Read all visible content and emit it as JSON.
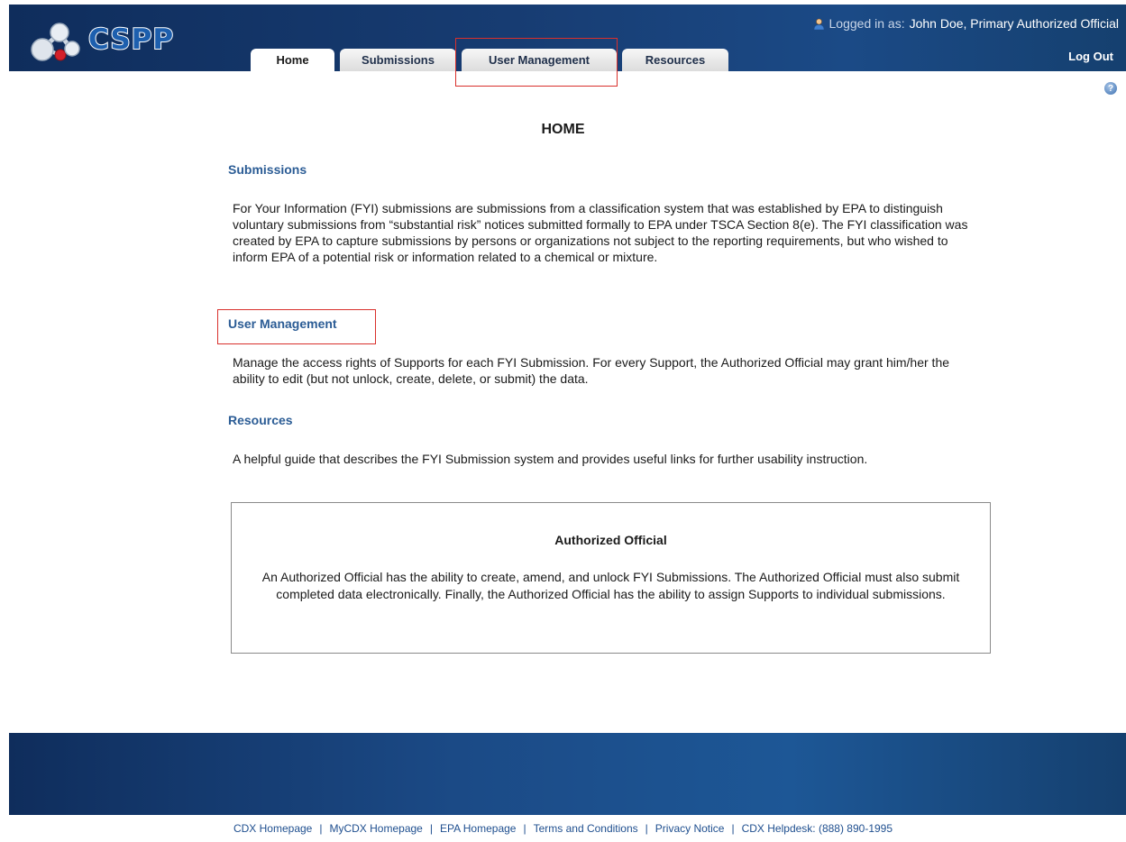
{
  "app": {
    "logo_text": "CSPP"
  },
  "header": {
    "login_label": "Logged in as:",
    "user_name": "John Doe, Primary Authorized Official",
    "logout_label": "Log Out"
  },
  "tabs": [
    {
      "label": "Home",
      "active": true
    },
    {
      "label": "Submissions",
      "active": false
    },
    {
      "label": "User Management",
      "active": false
    },
    {
      "label": "Resources",
      "active": false
    }
  ],
  "help_icon_glyph": "?",
  "main": {
    "page_title": "HOME",
    "sections": [
      {
        "heading": "Submissions",
        "text": "For Your Information (FYI) submissions are submissions from a classification system that was established by EPA to distinguish voluntary submissions from “substantial risk” notices submitted formally to EPA under TSCA Section 8(e). The FYI classification was created by EPA to capture submissions by persons or organizations not subject to the reporting requirements, but who wished to inform EPA of a potential risk or information related to a chemical or mixture."
      },
      {
        "heading": "User Management",
        "text": "Manage the access rights of Supports for each FYI Submission. For every Support, the Authorized Official may grant him/her the ability to edit (but not unlock, create, delete, or submit) the data."
      },
      {
        "heading": "Resources",
        "text": "A helpful guide that describes the FYI Submission system and provides useful links for further usability instruction."
      }
    ],
    "info_box": {
      "title": "Authorized Official",
      "text": "An Authorized Official has the ability to create, amend, and unlock FYI Submissions. The Authorized Official must also submit completed data electronically. Finally, the Authorized Official has the ability to assign Supports to individual submissions."
    }
  },
  "footer": {
    "links": [
      "CDX Homepage",
      "MyCDX Homepage",
      "EPA Homepage",
      "Terms and Conditions",
      "Privacy Notice",
      "CDX Helpdesk: (888) 890-1995"
    ],
    "separator": "|"
  },
  "colors": {
    "header_bg": "#173c72",
    "section_heading": "#2b5c95",
    "highlight_box": "#d9302c",
    "footer_link": "#1f4f8f"
  }
}
